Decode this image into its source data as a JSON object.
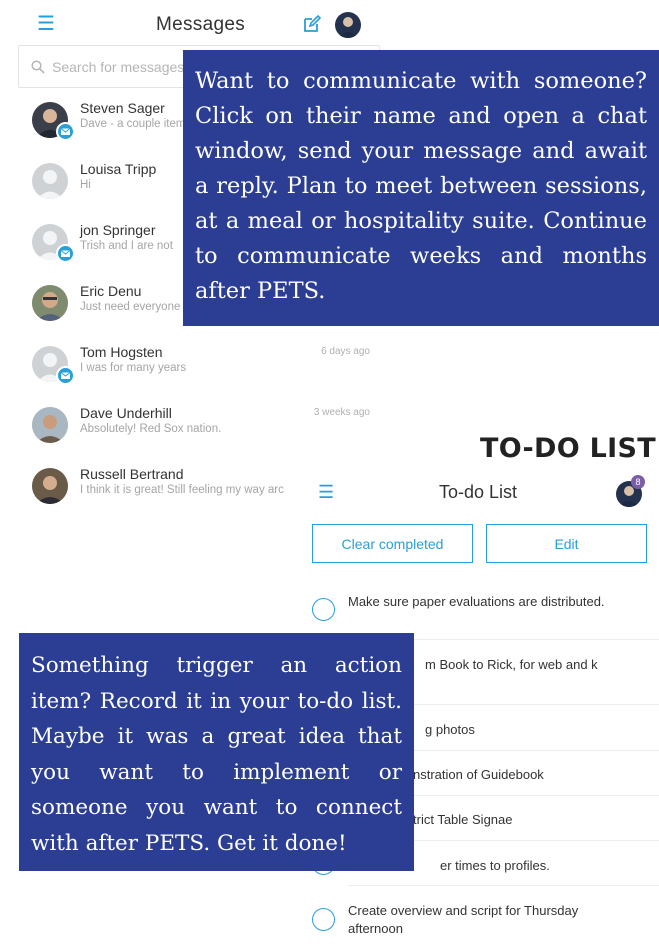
{
  "messages_screen": {
    "title": "Messages",
    "search_placeholder": "Search for messages",
    "conversations": [
      {
        "name": "Steven Sager",
        "snippet": "Dave - a couple items",
        "time": "",
        "unread": true
      },
      {
        "name": "Louisa Tripp",
        "snippet": "Hi",
        "time": "",
        "unread": false
      },
      {
        "name": "jon Springer",
        "snippet": "Trish and I are not",
        "time": "",
        "unread": true
      },
      {
        "name": "Eric Denu",
        "snippet": "Just need everyone",
        "time": "",
        "unread": false
      },
      {
        "name": "Tom Hogsten",
        "snippet": "I was for many years",
        "time": "6 days ago",
        "unread": true
      },
      {
        "name": "Dave Underhill",
        "snippet": "Absolutely!  Red Sox nation.",
        "time": "3 weeks ago",
        "unread": false
      },
      {
        "name": "Russell Bertrand",
        "snippet": "I think it is great! Still feeling my way arc",
        "time": "",
        "unread": false
      }
    ]
  },
  "callouts": {
    "messages": "Want to communicate with someone? Click on their name and open a chat window, send your message and await a reply. Plan to meet between sessions, at a meal or hospitality suite. Continue to communicate weeks and months after PETS.",
    "todo": "Something trigger an action item? Record it in your to-do list. Maybe it was a great idea that you want to implement or someone you want to connect with after PETS. Get it done!"
  },
  "todo_heading": "TO-DO LIST",
  "todo_screen": {
    "title": "To-do List",
    "badge_count": "8",
    "clear_label": "Clear completed",
    "edit_label": "Edit",
    "items": [
      {
        "text": "Make sure paper evaluations are distributed."
      },
      {
        "text": "m Book to Rick, for web and k"
      },
      {
        "text": "g photos"
      },
      {
        "text": "nstration of Guidebook"
      },
      {
        "text": "trict Table Signae"
      },
      {
        "text": "er times to profiles."
      },
      {
        "text": "Create overview and script for Thursday afternoon"
      }
    ]
  },
  "colors": {
    "accent": "#2a9fd6",
    "callout": "#2b3e93"
  }
}
